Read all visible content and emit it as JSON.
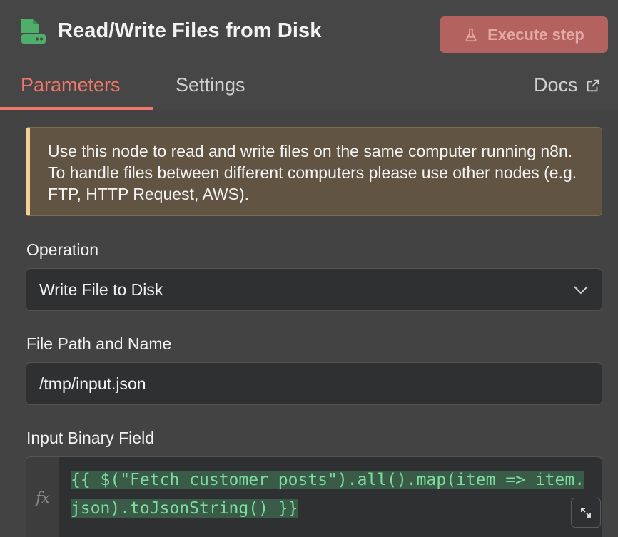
{
  "node": {
    "title": "Read/Write Files from Disk",
    "icon": "file-disk-icon",
    "accent_color": "#4fae6a"
  },
  "toolbar": {
    "execute_label": "Execute step",
    "execute_icon": "flask-icon"
  },
  "tabs": [
    {
      "label": "Parameters",
      "active": true
    },
    {
      "label": "Settings",
      "active": false
    }
  ],
  "docs": {
    "label": "Docs",
    "icon": "external-link-icon"
  },
  "notice": {
    "text": "Use this node to read and write files on the same computer running n8n. To handle files between different computers please use other nodes (e.g. FTP, HTTP Request, AWS)."
  },
  "fields": {
    "operation": {
      "label": "Operation",
      "value": "Write File to Disk"
    },
    "file_path": {
      "label": "File Path and Name",
      "value": "/tmp/input.json"
    },
    "binary_field": {
      "label": "Input Binary Field",
      "fx_label": "fx",
      "value": "{{ $(\"Fetch customer posts\").all().map(item => item.json).toJsonString() }}"
    }
  },
  "colors": {
    "active_tab": "#f0786a",
    "execute_button": "#b4625f",
    "notice_border": "#f4cf95",
    "expression_text": "#7ddc9e"
  }
}
